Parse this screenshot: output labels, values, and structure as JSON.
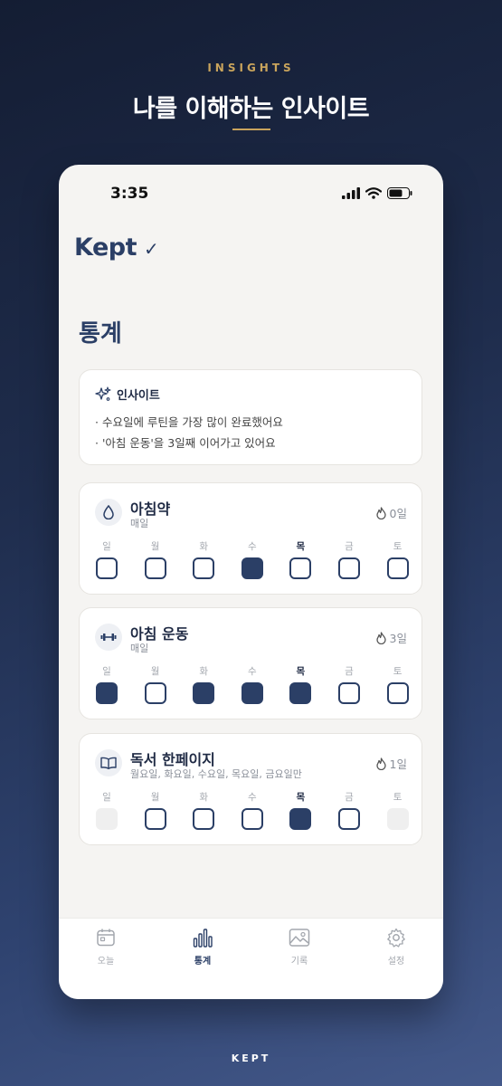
{
  "promo": {
    "eyebrow": "INSIGHTS",
    "headline": "나를 이해하는 인사이트",
    "footer": "KEPT"
  },
  "status_bar": {
    "time": "3:35"
  },
  "app": {
    "brand": "Kept",
    "check": "✓"
  },
  "page": {
    "title": "통계"
  },
  "insight": {
    "title": "인사이트",
    "lines": [
      "· 수요일에 루틴을 가장 많이 완료했어요",
      "· '아침 운동'을 3일째 이어가고 있어요"
    ]
  },
  "weekdays": [
    "일",
    "월",
    "화",
    "수",
    "목",
    "금",
    "토"
  ],
  "today_index": 4,
  "habits": [
    {
      "name": "아침약",
      "frequency": "매일",
      "streak": "0일",
      "icon": "drop-icon",
      "states": [
        "empty",
        "empty",
        "empty",
        "done",
        "empty",
        "empty",
        "empty"
      ]
    },
    {
      "name": "아침 운동",
      "frequency": "매일",
      "streak": "3일",
      "icon": "dumbbell-icon",
      "states": [
        "done",
        "empty",
        "done",
        "done",
        "done",
        "empty",
        "empty"
      ]
    },
    {
      "name": "독서 한페이지",
      "frequency": "월요일, 화요일, 수요일, 목요일, 금요일만",
      "streak": "1일",
      "icon": "book-icon",
      "states": [
        "na",
        "empty",
        "empty",
        "empty",
        "done",
        "empty",
        "na"
      ]
    }
  ],
  "tabs": [
    {
      "label": "오늘",
      "icon": "calendar-icon"
    },
    {
      "label": "통계",
      "icon": "bar-chart-icon",
      "active": true
    },
    {
      "label": "기록",
      "icon": "gallery-icon"
    },
    {
      "label": "설정",
      "icon": "gear-icon"
    }
  ],
  "colors": {
    "accent": "#2b3f66",
    "gold": "#c9a45c"
  }
}
